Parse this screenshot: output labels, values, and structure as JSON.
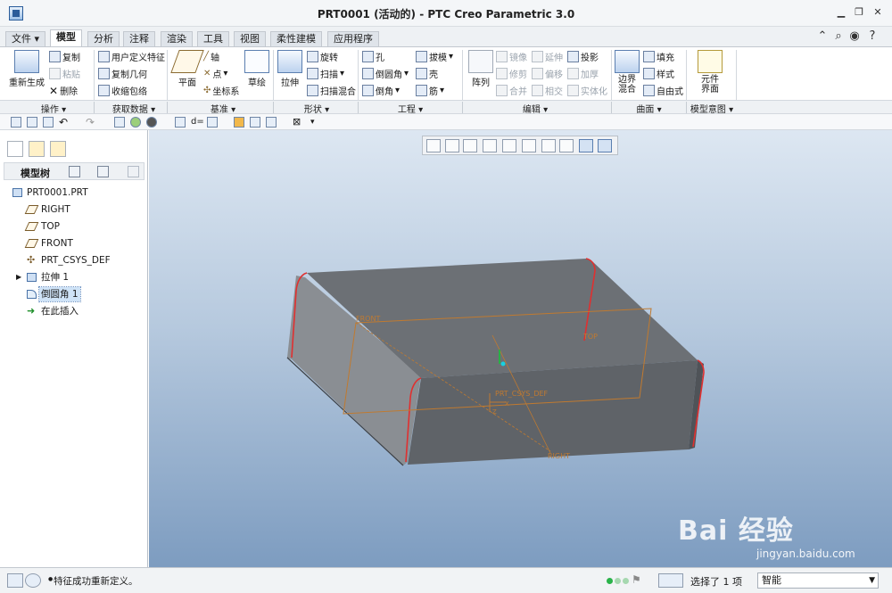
{
  "window": {
    "title": "PRT0001 (活动的) - PTC Creo Parametric 3.0"
  },
  "tabs": [
    {
      "label": "文件 ▾"
    },
    {
      "label": "模型"
    },
    {
      "label": "分析"
    },
    {
      "label": "注释"
    },
    {
      "label": "渲染"
    },
    {
      "label": "工具"
    },
    {
      "label": "视图"
    },
    {
      "label": "柔性建模"
    },
    {
      "label": "应用程序"
    }
  ],
  "active_tab": "模型",
  "ribbon": {
    "operations": {
      "regenerate": "重新生成",
      "copy": "复制",
      "paste": "粘贴",
      "delete": "删除"
    },
    "get_data": {
      "udf": "用户定义特征",
      "copy_geom": "复制几何",
      "shrinkwrap": "收缩包络"
    },
    "datum": {
      "plane": "平面",
      "axis": "轴",
      "point": "点",
      "csys": "坐标系",
      "sketch": "草绘"
    },
    "shapes": {
      "extrude": "拉伸",
      "revolve": "旋转",
      "sweep": "扫描",
      "swept_blend": "扫描混合"
    },
    "engineering": {
      "hole": "孔",
      "round": "倒圆角",
      "chamfer": "倒角",
      "draft": "拔模",
      "shell": "壳",
      "rib": "筋"
    },
    "editing": {
      "pattern": "阵列",
      "mirror": "镜像",
      "trim": "修剪",
      "merge": "合并",
      "extend": "延伸",
      "offset": "偏移",
      "intersect": "相交",
      "project": "投影",
      "thicken": "加厚",
      "solidify": "实体化"
    },
    "surfaces": {
      "boundary_blend": "边界混合",
      "fill": "填充",
      "style": "样式",
      "freestyle": "自由式"
    },
    "model_intent": {
      "component_interface": "元件界面"
    }
  },
  "groups": [
    "操作 ▾",
    "获取数据 ▾",
    "基准 ▾",
    "形状 ▾",
    "工程 ▾",
    "编辑 ▾",
    "曲面 ▾",
    "模型意图 ▾"
  ],
  "model_tree": {
    "title": "模型树",
    "items": [
      {
        "label": "PRT0001.PRT",
        "icon": "part-icon"
      },
      {
        "label": "RIGHT",
        "icon": "datum-plane-icon"
      },
      {
        "label": "TOP",
        "icon": "datum-plane-icon"
      },
      {
        "label": "FRONT",
        "icon": "datum-plane-icon"
      },
      {
        "label": "PRT_CSYS_DEF",
        "icon": "csys-icon"
      },
      {
        "label": "拉伸 1",
        "icon": "extrude-icon"
      },
      {
        "label": "倒圆角 1",
        "icon": "round-icon"
      },
      {
        "label": "在此插入",
        "icon": "insert-arrow-icon"
      }
    ]
  },
  "viewport": {
    "labels": {
      "front": "FRONT",
      "top": "TOP",
      "right": "RIGHT",
      "csys": "PRT_CSYS_DEF",
      "csys_x": "X",
      "csys_z": "Z"
    }
  },
  "status": {
    "message": "特征成功重新定义。",
    "selection": "选择了 1 项",
    "filter": "智能"
  },
  "watermark": {
    "logo": "Bai 经验",
    "url": "jingyan.baidu.com"
  },
  "colors": {
    "viewport_top": "#dde7f2",
    "viewport_bottom": "#7d9cc0",
    "model_body": "#6f7378",
    "round_edge": "#e03030",
    "datum": "#c07a30"
  }
}
